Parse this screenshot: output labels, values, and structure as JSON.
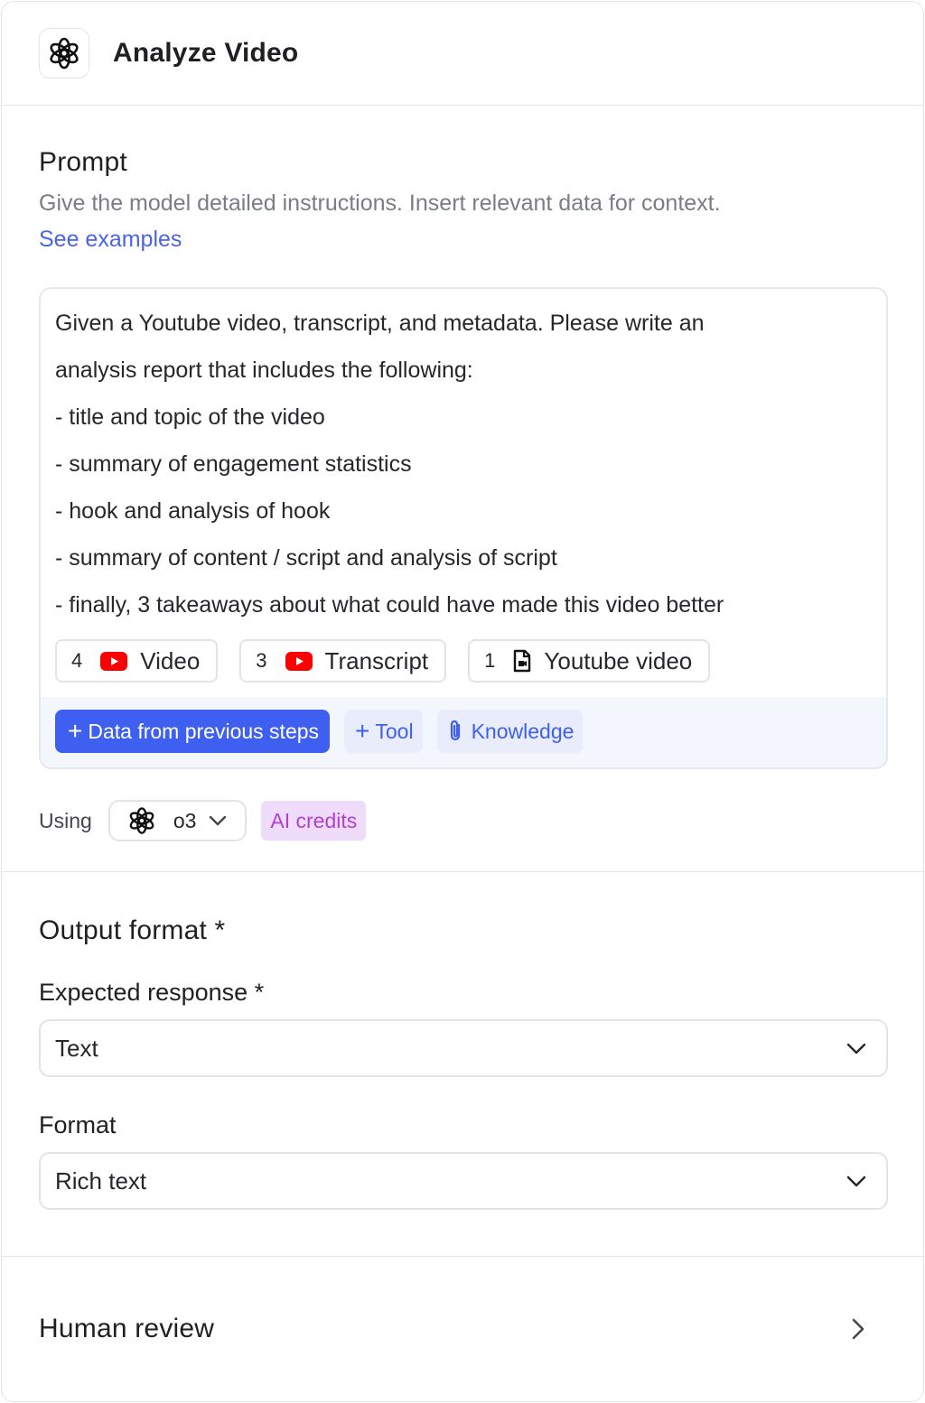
{
  "header": {
    "title": "Analyze Video",
    "icon": "openai-logo-icon"
  },
  "prompt": {
    "title": "Prompt",
    "description": "Give the model detailed instructions. Insert relevant data for context.",
    "examples_link": "See examples",
    "lines": [
      "Given a Youtube video, transcript, and metadata. Please write an",
      "analysis report that includes the following:",
      "- title and topic of the video",
      "- summary of engagement statistics",
      "- hook and analysis of hook",
      "- summary of content / script and analysis of script",
      "- finally, 3 takeaways about what could have made this video better"
    ],
    "chips": [
      {
        "count": "4",
        "icon": "youtube-icon",
        "label": "Video"
      },
      {
        "count": "3",
        "icon": "youtube-icon",
        "label": "Transcript"
      },
      {
        "count": "1",
        "icon": "document-icon",
        "label": "Youtube video"
      }
    ],
    "actions": {
      "data_button": "Data from previous steps",
      "tool_button": "Tool",
      "knowledge_button": "Knowledge"
    },
    "using_label": "Using",
    "model": "o3",
    "credits_badge": "AI credits"
  },
  "output": {
    "title": "Output format *",
    "expected_label": "Expected response *",
    "expected_value": "Text",
    "format_label": "Format",
    "format_value": "Rich text"
  },
  "review": {
    "title": "Human review"
  },
  "colors": {
    "accent": "#3e5ff0",
    "link": "#4a63e8",
    "youtube": "#ff0000",
    "credits_bg": "#eedcfa",
    "credits_text": "#b13fd7"
  }
}
